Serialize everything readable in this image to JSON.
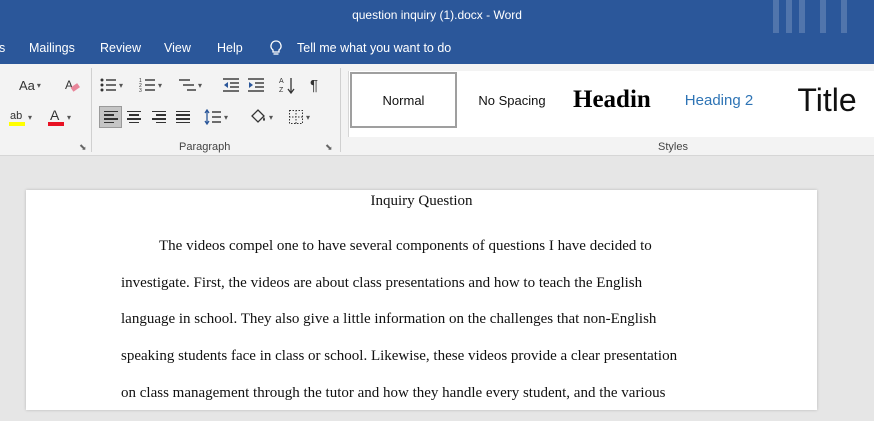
{
  "window": {
    "title": "question inquiry (1).docx  -  Word"
  },
  "menu": {
    "items": [
      "s",
      "Mailings",
      "Review",
      "View",
      "Help"
    ],
    "tell_me": "Tell me what you want to do"
  },
  "ribbon": {
    "groups": {
      "paragraph": "Paragraph",
      "styles": "Styles"
    },
    "font_case_label": "Aa",
    "styles": [
      {
        "label": "Normal",
        "selected": true
      },
      {
        "label": "No Spacing"
      },
      {
        "label": "Headin"
      },
      {
        "label": "Heading 2"
      },
      {
        "label": "Title"
      }
    ]
  },
  "document": {
    "title": "Inquiry Question",
    "lines": [
      "The videos compel one to have several components of questions I have decided to",
      "investigate. First, the videos are about class presentations and how to teach the English",
      "language in school. They also give a little information on the challenges that non-English",
      "speaking students face in class or school. Likewise, these videos provide a clear presentation",
      "on class management through the tutor and how they handle every student, and the various"
    ]
  },
  "colors": {
    "brand": "#2b579a",
    "highlight": "#ffff00",
    "font_color": "#e81123",
    "ribbon_bg": "#f3f3f3",
    "heading2": "#2e74b5"
  }
}
